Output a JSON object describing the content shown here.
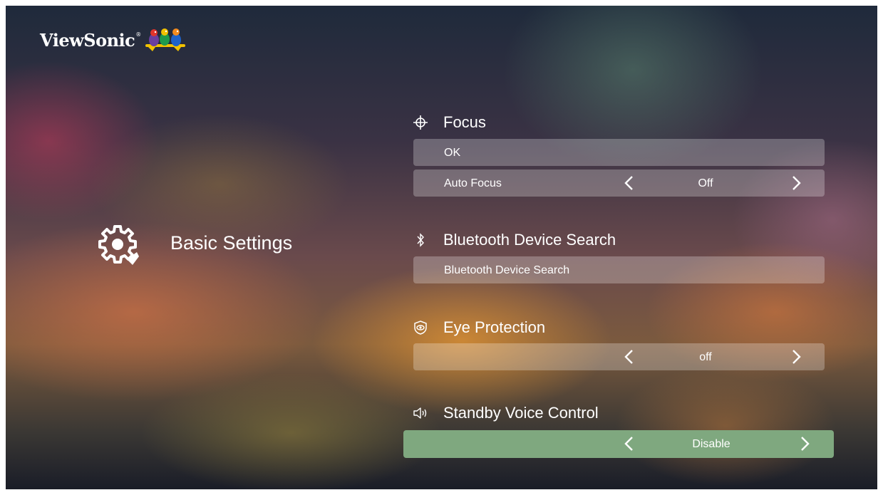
{
  "brand": {
    "name": "ViewSonic",
    "reg": "®"
  },
  "section": {
    "title": "Basic Settings",
    "icon": "gear-settings-icon"
  },
  "groups": {
    "focus": {
      "title": "Focus",
      "icon": "crosshair-icon",
      "ok_label": "OK",
      "auto_focus_label": "Auto Focus",
      "auto_focus_value": "Off"
    },
    "bluetooth": {
      "title": "Bluetooth Device Search",
      "icon": "bluetooth-icon",
      "row_label": "Bluetooth Device Search"
    },
    "eye_protection": {
      "title": "Eye Protection",
      "icon": "eye-shield-icon",
      "value": "off"
    },
    "standby_voice": {
      "title": "Standby Voice Control",
      "icon": "speaker-icon",
      "value": "Disable"
    }
  },
  "colors": {
    "row_background": "rgba(255,255,255,0.26)",
    "selected_background": "#7fa87f",
    "text": "#ffffff"
  }
}
